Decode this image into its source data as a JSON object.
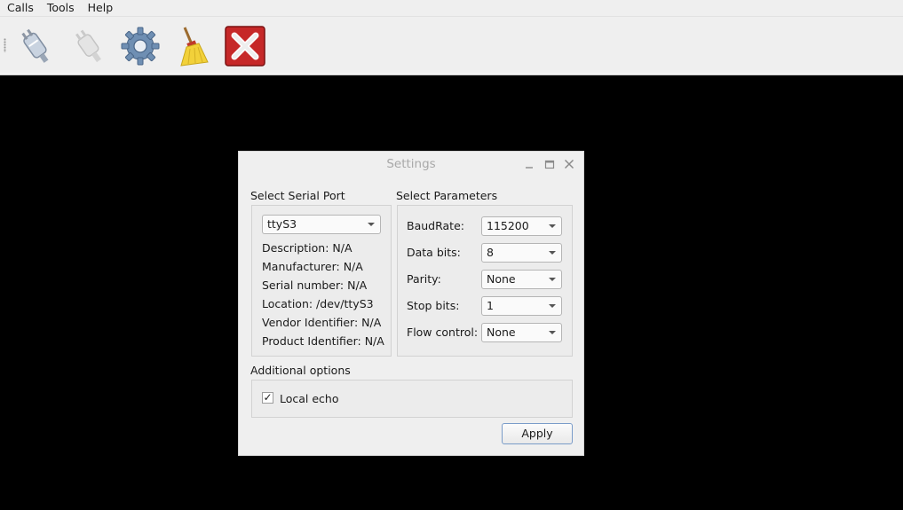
{
  "menubar": {
    "items": [
      "Calls",
      "Tools",
      "Help"
    ]
  },
  "toolbar": {
    "tools": [
      {
        "icon": "connect-plug-icon"
      },
      {
        "icon": "disconnect-plug-icon"
      },
      {
        "icon": "gear-icon"
      },
      {
        "icon": "broom-icon"
      },
      {
        "icon": "close-red-x-icon"
      }
    ]
  },
  "dialog": {
    "title": "Settings",
    "serial_port": {
      "heading": "Select Serial Port",
      "selected": "ttyS3",
      "description": "Description: N/A",
      "manufacturer": "Manufacturer: N/A",
      "serial_number": "Serial number: N/A",
      "location": "Location: /dev/ttyS3",
      "vendor_id": "Vendor Identifier: N/A",
      "product_id": "Product Identifier: N/A"
    },
    "parameters": {
      "heading": "Select Parameters",
      "baud_label": "BaudRate:",
      "baud_value": "115200",
      "data_label": "Data bits:",
      "data_value": "8",
      "parity_label": "Parity:",
      "parity_value": "None",
      "stop_label": "Stop bits:",
      "stop_value": "1",
      "flow_label": "Flow control:",
      "flow_value": "None"
    },
    "additional": {
      "heading": "Additional options",
      "local_echo_label": "Local echo",
      "local_echo_checked": true,
      "check_mark": "✓"
    },
    "apply_label": "Apply"
  }
}
